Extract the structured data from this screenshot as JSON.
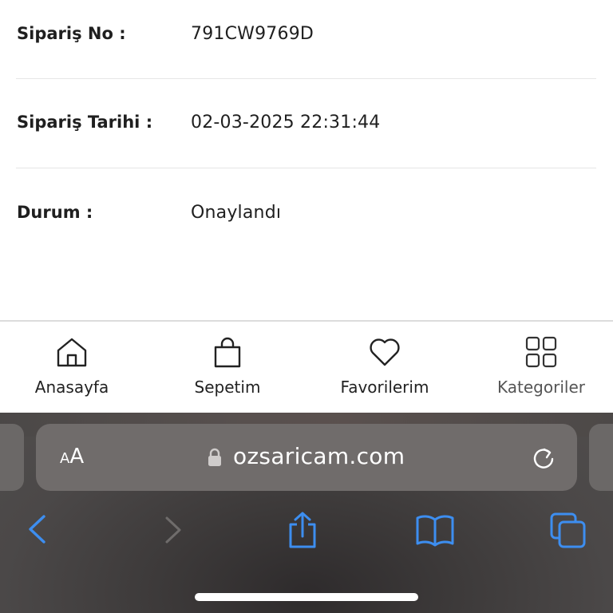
{
  "order": {
    "order_no": {
      "label": "Sipariş No :",
      "value": "791CW9769D"
    },
    "order_date": {
      "label": "Sipariş Tarihi :",
      "value": "02-03-2025 22:31:44"
    },
    "status": {
      "label": "Durum :",
      "value": "Onaylandı"
    }
  },
  "bottom_nav": {
    "items": [
      {
        "label": "Anasayfa",
        "icon": "home-icon"
      },
      {
        "label": "Sepetim",
        "icon": "shopping-bag-icon"
      },
      {
        "label": "Favorilerim",
        "icon": "heart-icon"
      },
      {
        "label": "Kategoriler",
        "icon": "grid-icon"
      }
    ]
  },
  "browser": {
    "aa_big": "A",
    "aa_small": "A",
    "domain": "ozsaricam.com",
    "accent": "#3d8ef0",
    "toolbar": [
      "back-icon",
      "forward-icon",
      "share-icon",
      "bookmarks-icon",
      "tabs-icon"
    ]
  }
}
